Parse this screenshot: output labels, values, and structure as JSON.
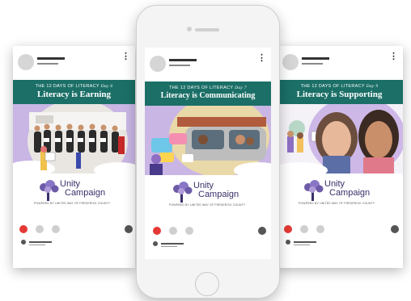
{
  "posts": [
    {
      "kicker": "THE 12 DAYS OF LITERACY",
      "day": "Day 6",
      "title": "Literacy is Earning"
    },
    {
      "kicker": "THE 12 DAYS OF LITERACY",
      "day": "Day 7",
      "title": "Literacy is Communicating"
    },
    {
      "kicker": "THE 12 DAYS OF LITERACY",
      "day": "Day 9",
      "title": "Literacy is Supporting"
    }
  ],
  "logo": {
    "line1": "Unity",
    "line2": "Campaign",
    "tagline": "POWERED BY UNITED WAY OF FREDERICK COUNTY"
  },
  "colors": {
    "banner": "#1b6f67",
    "logo_text": "#3a2f6a",
    "active_dot": "#e53935",
    "photo_bg_purple": "#c9b6e4"
  }
}
